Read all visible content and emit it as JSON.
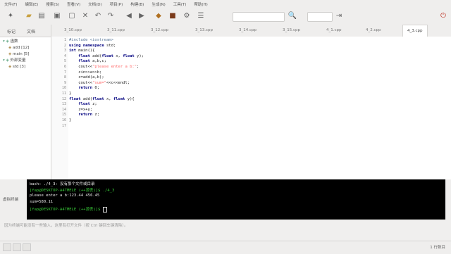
{
  "menu": [
    "文件(F)",
    "编辑(E)",
    "搜索(S)",
    "查看(V)",
    "文档(D)",
    "项目(P)",
    "构建(B)",
    "生成(N)",
    "工具(T)",
    "帮助(H)"
  ],
  "sidebar": {
    "tabs": [
      "标记",
      "文档"
    ],
    "tree": [
      {
        "label": "函数",
        "indent": 0
      },
      {
        "label": "add [12]",
        "indent": 1
      },
      {
        "label": "main [5]",
        "indent": 1
      },
      {
        "label": "外部变量",
        "indent": 0
      },
      {
        "label": "std [3]",
        "indent": 1
      }
    ]
  },
  "editor_tabs": [
    "3_10.cpp",
    "3_11.cpp",
    "3_12.cpp",
    "3_13.cpp",
    "3_14.cpp",
    "3_15.cpp",
    "4_1.cpp",
    "4_2.cpp",
    "4_3.cpp"
  ],
  "active_tab": "4_3.cpp",
  "code": {
    "line_numbers": [
      "1",
      "2",
      "3",
      "4",
      "5",
      "6",
      "7",
      "8",
      "9",
      "10",
      "11",
      "12",
      "13",
      "14",
      "15",
      "16",
      "17"
    ],
    "lines": [
      "#include <iostream>",
      "using namespace std;",
      "int main(){",
      "    float add(float x, float y);",
      "    float a,b,c;",
      "    cout<<\"please enter a b:\";",
      "    cin>>a>>b;",
      "    c=add(a,b);",
      "    cout<<\"sum=\"<<c<<endl;",
      "    return 0;",
      "}",
      "float add(float x, float y){",
      "    float z;",
      "    z=x+y;",
      "    return z;",
      "}",
      ""
    ]
  },
  "terminal": {
    "panel_label": "虚拟终端",
    "lines": [
      "bash: ./4_3: 没有那个文件或目录",
      "[fap@DESKTOP-A4TMELE (++源丢)]$ ./4_3",
      "please enter a b:123.44 456.45",
      "sum=580.11",
      "[fap@DESKTOP-A4TMELE (++源丢)]$ "
    ]
  },
  "hint": "因为终端可能没有一些输入，这里有打开文件（按 Ctrl 键回车键清除）。",
  "status": "1 行数目"
}
